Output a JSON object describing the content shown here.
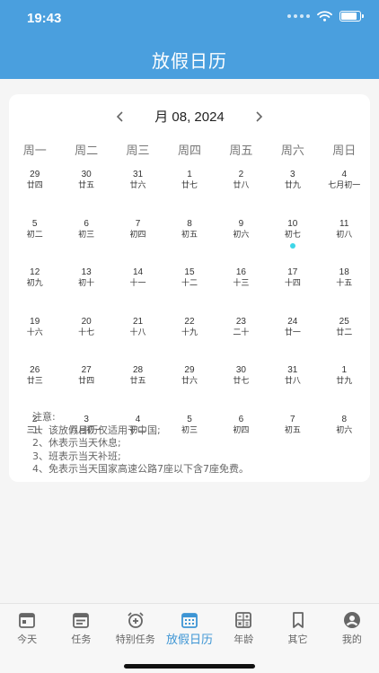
{
  "status_bar": {
    "time": "19:43"
  },
  "header": {
    "title": "放假日历"
  },
  "calendar": {
    "month_label": "月 08, 2024",
    "weekdays": [
      "周一",
      "周二",
      "周三",
      "周四",
      "周五",
      "周六",
      "周日"
    ],
    "weeks": [
      [
        {
          "day": "29",
          "lunar": "廿四"
        },
        {
          "day": "30",
          "lunar": "廿五"
        },
        {
          "day": "31",
          "lunar": "廿六"
        },
        {
          "day": "1",
          "lunar": "廿七"
        },
        {
          "day": "2",
          "lunar": "廿八"
        },
        {
          "day": "3",
          "lunar": "廿九"
        },
        {
          "day": "4",
          "lunar": "七月初一"
        }
      ],
      [
        {
          "day": "5",
          "lunar": "初二"
        },
        {
          "day": "6",
          "lunar": "初三"
        },
        {
          "day": "7",
          "lunar": "初四"
        },
        {
          "day": "8",
          "lunar": "初五"
        },
        {
          "day": "9",
          "lunar": "初六"
        },
        {
          "day": "10",
          "lunar": "初七",
          "today": true
        },
        {
          "day": "11",
          "lunar": "初八"
        }
      ],
      [
        {
          "day": "12",
          "lunar": "初九"
        },
        {
          "day": "13",
          "lunar": "初十"
        },
        {
          "day": "14",
          "lunar": "十一"
        },
        {
          "day": "15",
          "lunar": "十二"
        },
        {
          "day": "16",
          "lunar": "十三"
        },
        {
          "day": "17",
          "lunar": "十四"
        },
        {
          "day": "18",
          "lunar": "十五"
        }
      ],
      [
        {
          "day": "19",
          "lunar": "十六"
        },
        {
          "day": "20",
          "lunar": "十七"
        },
        {
          "day": "21",
          "lunar": "十八"
        },
        {
          "day": "22",
          "lunar": "十九"
        },
        {
          "day": "23",
          "lunar": "二十"
        },
        {
          "day": "24",
          "lunar": "廿一"
        },
        {
          "day": "25",
          "lunar": "廿二"
        }
      ],
      [
        {
          "day": "26",
          "lunar": "廿三"
        },
        {
          "day": "27",
          "lunar": "廿四"
        },
        {
          "day": "28",
          "lunar": "廿五"
        },
        {
          "day": "29",
          "lunar": "廿六"
        },
        {
          "day": "30",
          "lunar": "廿七"
        },
        {
          "day": "31",
          "lunar": "廿八"
        },
        {
          "day": "1",
          "lunar": "廿九"
        }
      ],
      [
        {
          "day": "2",
          "lunar": "三十"
        },
        {
          "day": "3",
          "lunar": "八月初一"
        },
        {
          "day": "4",
          "lunar": "初二"
        },
        {
          "day": "5",
          "lunar": "初三"
        },
        {
          "day": "6",
          "lunar": "初四"
        },
        {
          "day": "7",
          "lunar": "初五"
        },
        {
          "day": "8",
          "lunar": "初六"
        }
      ]
    ]
  },
  "notes": {
    "heading": "注意:",
    "lines": [
      "1、该放假日历仅适用于中国;",
      "2、休表示当天休息;",
      "3、班表示当天补班;",
      "4、免表示当天国家高速公路7座以下含7座免费。"
    ]
  },
  "tabbar": {
    "items": [
      {
        "label": "今天",
        "icon": "calendar-today-icon"
      },
      {
        "label": "任务",
        "icon": "task-list-icon"
      },
      {
        "label": "特别任务",
        "icon": "alarm-clock-plus-icon"
      },
      {
        "label": "放假日历",
        "icon": "calendar-grid-icon",
        "active": true
      },
      {
        "label": "年龄",
        "icon": "calculator-icon"
      },
      {
        "label": "其它",
        "icon": "bookmark-icon"
      },
      {
        "label": "我的",
        "icon": "user-icon"
      }
    ]
  },
  "colors": {
    "header_bg": "#4a9fde",
    "active_tab": "#3d95d4",
    "today_dot": "#3dd6e8",
    "page_bg": "#f5f5f5"
  }
}
